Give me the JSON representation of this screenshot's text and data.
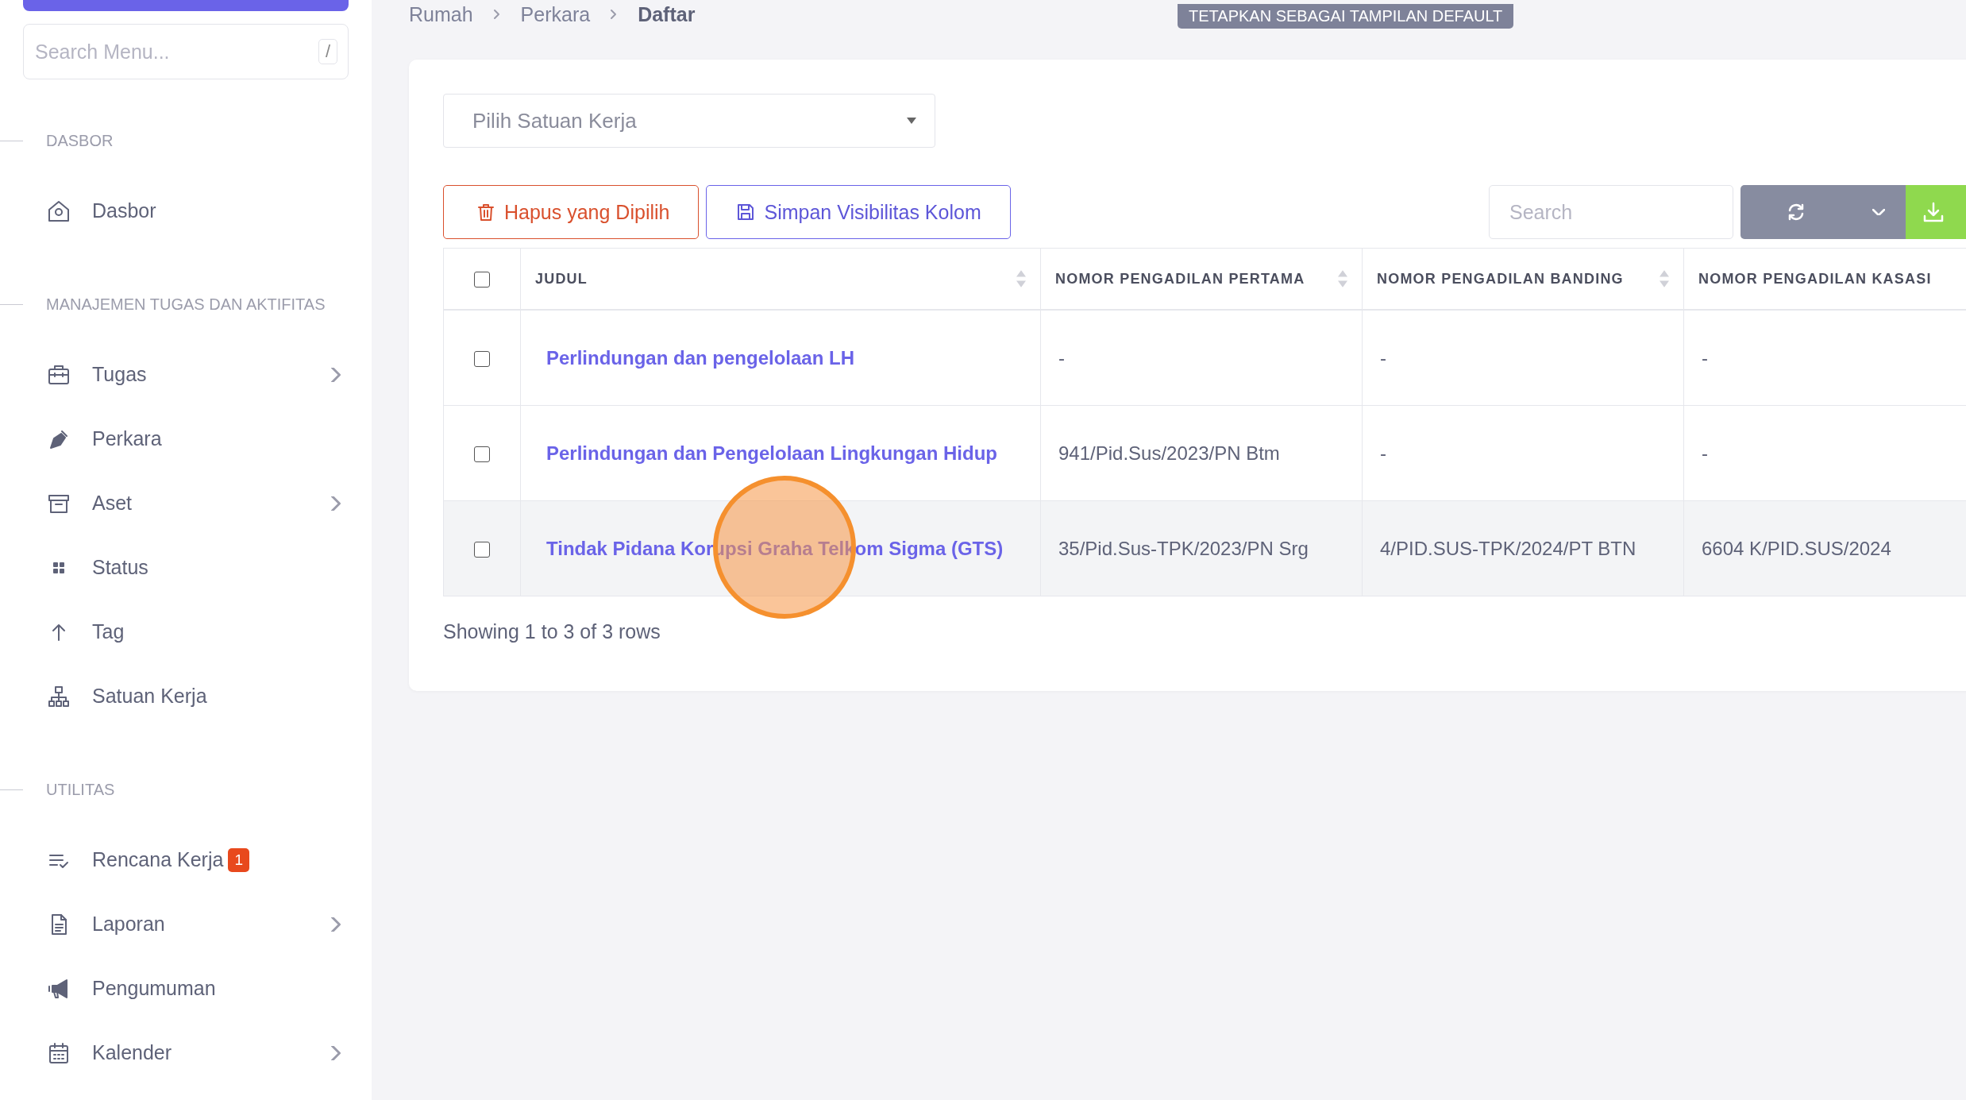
{
  "sidebar": {
    "search": {
      "placeholder": "Search Menu...",
      "shortcut": "/"
    },
    "sections": [
      {
        "title": "DASBOR",
        "items": [
          {
            "label": "Dasbor",
            "has_submenu": false
          }
        ]
      },
      {
        "title": "MANAJEMEN TUGAS DAN AKTIFITAS",
        "items": [
          {
            "label": "Tugas",
            "has_submenu": true
          },
          {
            "label": "Perkara",
            "has_submenu": false
          },
          {
            "label": "Aset",
            "has_submenu": true
          },
          {
            "label": "Status",
            "has_submenu": false
          },
          {
            "label": "Tag",
            "has_submenu": false
          },
          {
            "label": "Satuan Kerja",
            "has_submenu": false
          }
        ]
      },
      {
        "title": "UTILITAS",
        "items": [
          {
            "label": "Rencana Kerja",
            "has_submenu": false,
            "badge": "1"
          },
          {
            "label": "Laporan",
            "has_submenu": true
          },
          {
            "label": "Pengumuman",
            "has_submenu": false
          },
          {
            "label": "Kalender",
            "has_submenu": true
          }
        ]
      }
    ]
  },
  "breadcrumb": [
    {
      "label": "Rumah",
      "current": false
    },
    {
      "label": "Perkara",
      "current": false
    },
    {
      "label": "Daftar",
      "current": true
    }
  ],
  "default_view_button": "TETAPKAN SEBAGAI TAMPILAN DEFAULT",
  "filter": {
    "placeholder": "Pilih Satuan Kerja"
  },
  "toolbar": {
    "delete_button": "Hapus yang Dipilih",
    "save_columns_button": "Simpan Visibilitas Kolom",
    "search": {
      "placeholder": "Search"
    }
  },
  "table": {
    "select_all_checked": false,
    "columns": [
      {
        "label": "JUDUL",
        "sortable": true
      },
      {
        "label": "NOMOR PENGADILAN PERTAMA",
        "sortable": true
      },
      {
        "label": "NOMOR PENGADILAN BANDING",
        "sortable": true
      },
      {
        "label": "NOMOR PENGADILAN KASASI",
        "sortable": false
      }
    ],
    "rows": [
      {
        "checked": false,
        "hovered": false,
        "cells": [
          "Perlindungan dan pengelolaan LH",
          "-",
          "-",
          "-"
        ]
      },
      {
        "checked": false,
        "hovered": false,
        "cells": [
          "Perlindungan dan Pengelolaan Lingkungan Hidup",
          "941/Pid.Sus/2023/PN Btm",
          "-",
          "-"
        ]
      },
      {
        "checked": false,
        "hovered": true,
        "cells": [
          "Tindak Pidana Korupsi Graha Telkom Sigma (GTS)",
          "35/Pid.Sus-TPK/2023/PN Srg",
          "4/PID.SUS-TPK/2024/PT BTN",
          "6604 K/PID.SUS/2024"
        ]
      }
    ]
  },
  "pagination_info": "Showing 1 to 3 of 3 rows"
}
